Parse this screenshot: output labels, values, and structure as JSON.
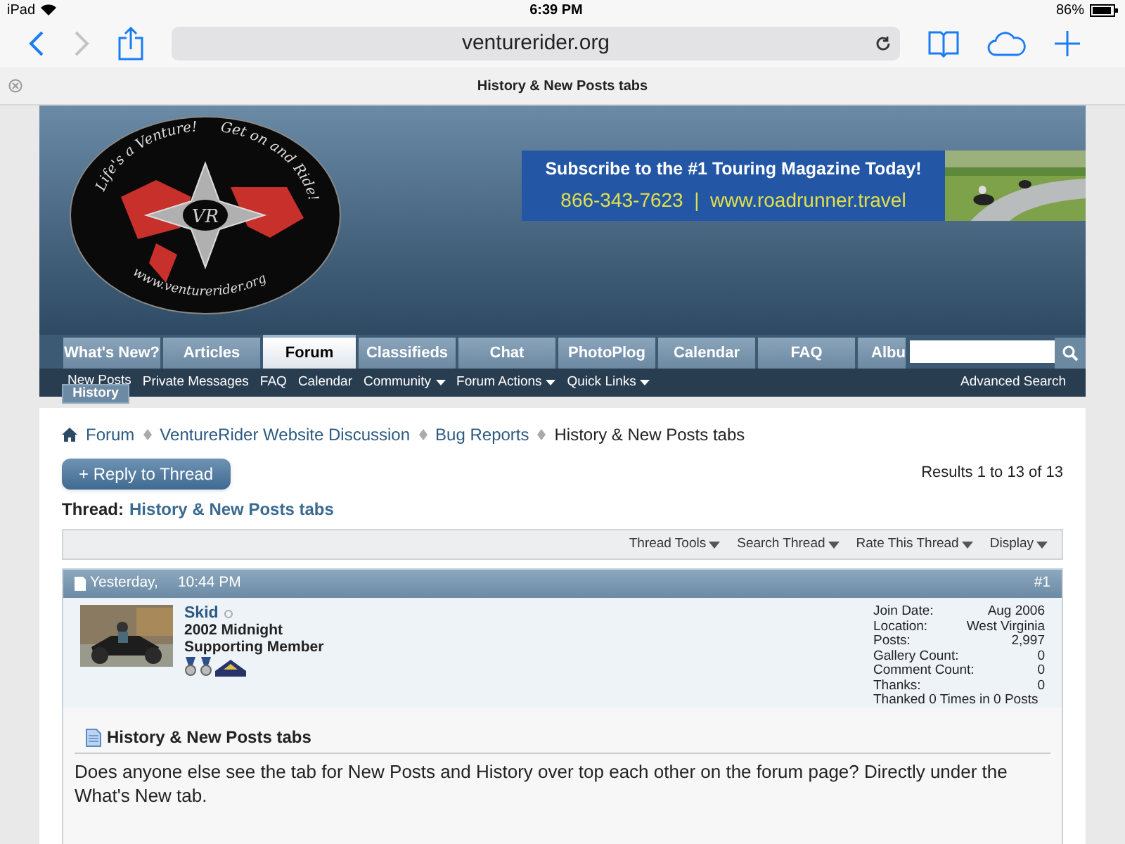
{
  "status_bar": {
    "device": "iPad",
    "time": "6:39 PM",
    "battery": "86%"
  },
  "browser": {
    "url": "venturerider.org",
    "tab_title": "History & New Posts tabs"
  },
  "logo": {
    "tagline_left": "Life's a Venture!",
    "tagline_right": "Get on and Ride!",
    "monogram": "VR",
    "site": "www.venturerider.org"
  },
  "ad": {
    "headline": "Subscribe to the #1 Touring Magazine Today!",
    "contact": "866-343-7623  |  www.roadrunner.travel"
  },
  "nav_tabs": [
    {
      "label": "What's New?",
      "selected": false
    },
    {
      "label": "Articles",
      "selected": false
    },
    {
      "label": "Forum",
      "selected": true
    },
    {
      "label": "Classifieds",
      "selected": false
    },
    {
      "label": "Chat",
      "selected": false
    },
    {
      "label": "PhotoPlog",
      "selected": false
    },
    {
      "label": "Calendar",
      "selected": false
    },
    {
      "label": "FAQ",
      "selected": false
    },
    {
      "label": "Albu",
      "selected": false
    }
  ],
  "sub_nav": [
    {
      "label": "New Posts",
      "dropdown": false
    },
    {
      "label": "Private Messages",
      "dropdown": false
    },
    {
      "label": "FAQ",
      "dropdown": false
    },
    {
      "label": "Calendar",
      "dropdown": false
    },
    {
      "label": "Community",
      "dropdown": true
    },
    {
      "label": "Forum Actions",
      "dropdown": true
    },
    {
      "label": "Quick Links",
      "dropdown": true
    }
  ],
  "overlay_tab": "History",
  "advanced_search": "Advanced Search",
  "breadcrumbs": [
    "Forum",
    "VentureRider Website Discussion",
    "Bug Reports"
  ],
  "breadcrumb_current": "History & New Posts tabs",
  "reply_button": "+ Reply to Thread",
  "results": "Results 1 to 13 of 13",
  "thread_label": "Thread:",
  "thread_title": "History & New Posts tabs",
  "thread_tools": [
    "Thread Tools",
    "Search Thread",
    "Rate This Thread",
    "Display"
  ],
  "post": {
    "day": "Yesterday,",
    "time": "10:44 PM",
    "number": "#1",
    "username": "Skid",
    "online": false,
    "bike": "2002 Midnight",
    "rank": "Supporting Member",
    "info": [
      {
        "label": "Join Date:",
        "value": "Aug 2006"
      },
      {
        "label": "Location:",
        "value": "West Virginia"
      },
      {
        "label": "Posts:",
        "value": "2,997"
      },
      {
        "label": "Gallery Count:",
        "value": "0"
      },
      {
        "label": "Comment Count:",
        "value": "0"
      },
      {
        "label": "Thanks:",
        "value": "0"
      }
    ],
    "thanked": "Thanked 0 Times in 0 Posts",
    "title": "History & New Posts tabs",
    "body": "Does anyone else see the tab for New Posts and History over top each other on the forum page? Directly under the What's New tab."
  }
}
